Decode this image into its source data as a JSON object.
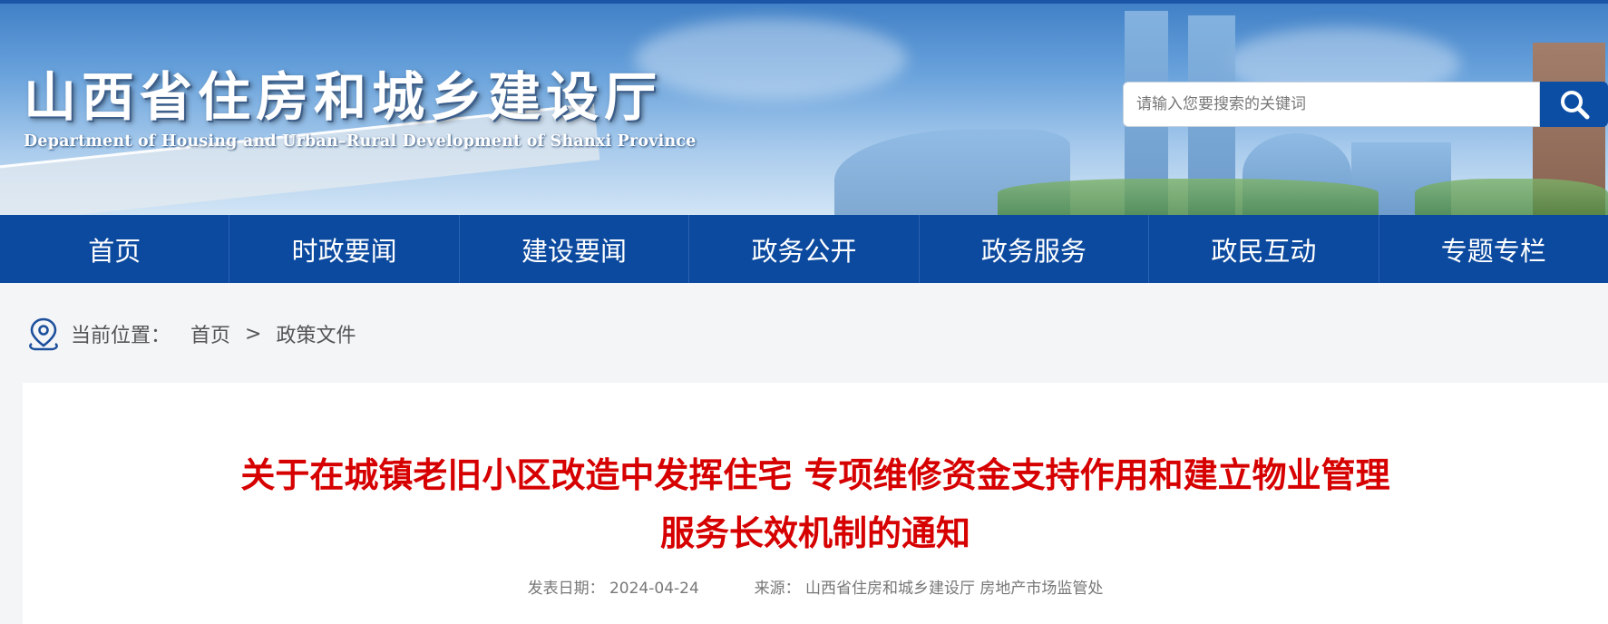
{
  "header": {
    "title": "山西省住房和城乡建设厅",
    "subtitle": "Department of Housing and Urban–Rural Development of Shanxi Province",
    "search_placeholder": "请输入您要搜索的关键词",
    "search_icon": "search-icon"
  },
  "nav": {
    "items": [
      "首页",
      "时政要闻",
      "建设要闻",
      "政务公开",
      "政务服务",
      "政民互动",
      "专题专栏"
    ]
  },
  "breadcrumb": {
    "icon": "location-pin-icon",
    "label": "当前位置：",
    "home": "首页",
    "separator": ">",
    "current": "政策文件"
  },
  "article": {
    "title_line1": "关于在城镇老旧小区改造中发挥住宅 专项维修资金支持作用和建立物业管理",
    "title_line2": "服务长效机制的通知",
    "date_label": "发表日期：",
    "date": "2024-04-24",
    "source_label": "来源：",
    "source": "山西省住房和城乡建设厅 房地产市场监管处"
  },
  "colors": {
    "nav_bg": "#0c4a9f",
    "title_red": "#d60000",
    "search_button": "#0d4ea5"
  }
}
